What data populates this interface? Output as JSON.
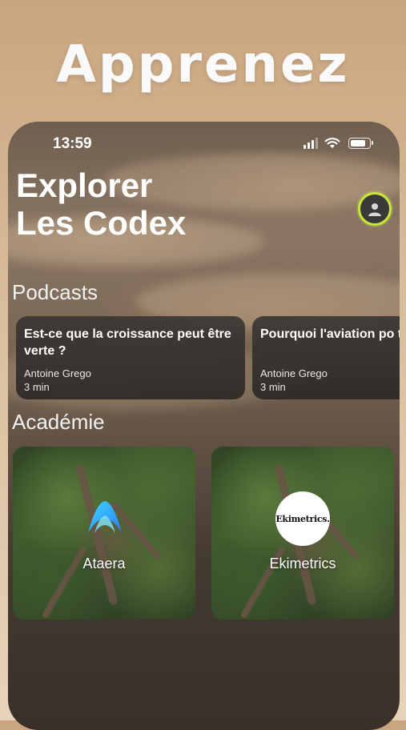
{
  "headline": "Apprenez",
  "status": {
    "time": "13:59"
  },
  "title": {
    "line1": "Explorer",
    "line2": "Les Codex"
  },
  "sections": {
    "podcasts": "Podcasts",
    "academie": "Académie"
  },
  "podcasts": [
    {
      "title": "Est-ce que la croissance peut être verte ?",
      "author": "Antoine Grego",
      "duration": "3 min"
    },
    {
      "title": "Pourquoi l'aviation pollue-t-elle ?",
      "title_visible": "Pourquoi l'aviation po t-elle ?",
      "author": "Antoine Grego",
      "duration": "3 min"
    }
  ],
  "academie": [
    {
      "name": "Ataera",
      "logo": "ataera-logo"
    },
    {
      "name": "Ekimetrics",
      "logo_text": "Ekimetrics."
    }
  ],
  "colors": {
    "accent_ring": "#c8e63b"
  }
}
